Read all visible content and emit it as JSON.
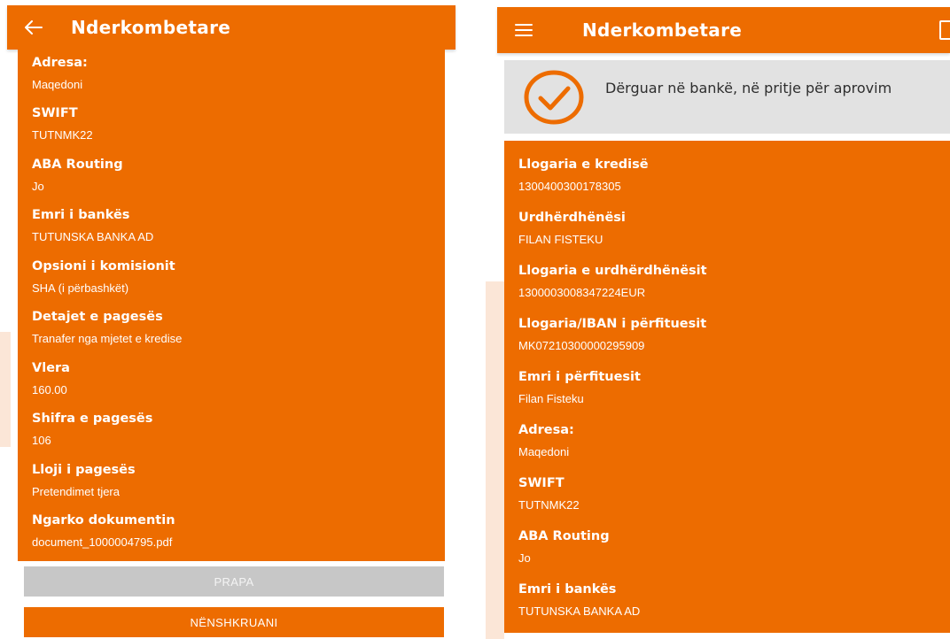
{
  "left": {
    "header": {
      "title": "Nderkombetare",
      "nav_icon": "back-arrow-icon"
    },
    "fields": [
      {
        "label": "Adresa:",
        "value": "Maqedoni"
      },
      {
        "label": "SWIFT",
        "value": "TUTNMK22"
      },
      {
        "label": "ABA Routing",
        "value": "Jo"
      },
      {
        "label": "Emri i bankës",
        "value": "TUTUNSKA BANKA AD"
      },
      {
        "label": "Opsioni i komisionit",
        "value": "SHA (i përbashkët)"
      },
      {
        "label": "Detajet e pagesës",
        "value": "Tranafer nga mjetet e kredise"
      },
      {
        "label": "Vlera",
        "value": "160.00"
      },
      {
        "label": "Shifra e pagesës",
        "value": "106"
      },
      {
        "label": "Lloji i pagesës",
        "value": "Pretendimet tjera"
      },
      {
        "label": "Ngarko dokumentin",
        "value": "document_1000004795.pdf"
      }
    ],
    "buttons": {
      "back_label": "PRAPA",
      "sign_label": "NËNSHKRUANI"
    }
  },
  "right": {
    "header": {
      "title": "Nderkombetare",
      "nav_icon": "hamburger-menu-icon",
      "action_icon": "document-icon"
    },
    "status": {
      "text": "Dërguar në bankë, në pritje për aprovim",
      "icon": "check-circle-icon"
    },
    "fields": [
      {
        "label": "Llogaria e kredisë",
        "value": "1300400300178305"
      },
      {
        "label": "Urdhërdhënësi",
        "value": "FILAN FISTEKU"
      },
      {
        "label": "Llogaria e urdhërdhënësit",
        "value": "1300003008347224EUR"
      },
      {
        "label": "Llogaria/IBAN i përfituesit",
        "value": "MK07210300000295909"
      },
      {
        "label": "Emri i përfituesit",
        "value": "Filan Fisteku"
      },
      {
        "label": "Adresa:",
        "value": "Maqedoni"
      },
      {
        "label": "SWIFT",
        "value": "TUTNMK22"
      },
      {
        "label": "ABA Routing",
        "value": "Jo"
      },
      {
        "label": "Emri i bankës",
        "value": "TUTUNSKA BANKA AD"
      }
    ]
  },
  "colors": {
    "accent": "#ed6c00",
    "status_bg": "#e2e2e2",
    "disabled_button": "#c7c7c7"
  }
}
